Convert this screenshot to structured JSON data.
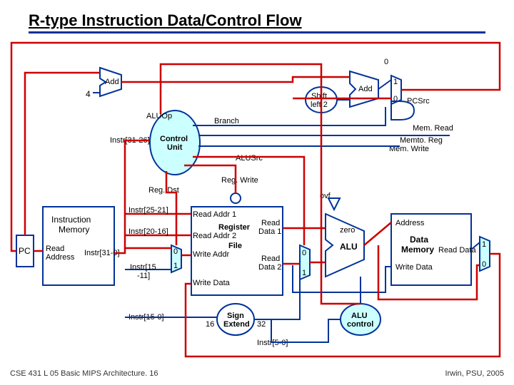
{
  "title": "R-type Instruction Data/Control Flow",
  "footer": {
    "left": "CSE 431  L 05 Basic MIPS Architecture. 16",
    "right": "Irwin, PSU, 2005"
  },
  "blocks": {
    "pc": "PC",
    "imem": "Instruction\nMemory",
    "imem_read": "Read\nAddress",
    "imem_out": "Instr[31-0]",
    "add1": "Add",
    "add2": "Add",
    "four": "4",
    "shl2": "Shift\nleft 2",
    "control": "Control\nUnit",
    "regfile": "Register\nFile",
    "ra1": "Read Addr 1",
    "ra2": "Read Addr 2",
    "wa": "Write Addr",
    "wd": "Write Data",
    "rd1": "Read\nData 1",
    "rd2": "Read\nData 2",
    "signext": "Sign\nExtend",
    "alu": "ALU",
    "aluctrl": "ALU\ncontrol",
    "dmem": "Data\nMemory",
    "dmem_addr": "Address",
    "dmem_wd": "Write Data",
    "dmem_rd": "Read Data"
  },
  "signals": {
    "aluop": "ALUOp",
    "branch": "Branch",
    "memread": "Mem. Read",
    "memtoreg": "Memto. Reg",
    "memwrite": "Mem. Write",
    "alusrc": "ALUSrc",
    "regwrite": "Reg. Write",
    "regdst": "Reg. Dst",
    "pcsrc": "PCSrc",
    "ovf": "ovf",
    "zero": "zero"
  },
  "fields": {
    "op": "Instr[31-26]",
    "rs": "Instr[25-21]",
    "rt": "Instr[20-16]",
    "rd": "Instr[15-11]",
    "imm": "Instr[15-0]",
    "funct": "Instr[5-0]",
    "se_in": "16",
    "se_out": "32"
  },
  "mux": {
    "zero": "0",
    "one": "1"
  }
}
